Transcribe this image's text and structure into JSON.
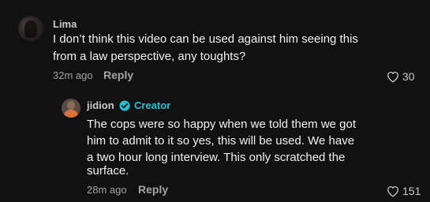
{
  "colors": {
    "background": "#111111",
    "creator_accent": "#20c0d6",
    "muted_text": "#a3a3a3"
  },
  "comment": {
    "username": "Lima",
    "lines": [
      "I don’t think this video can be used against him seeing this",
      "from a law perspective, any toughts?"
    ],
    "time": "32m ago",
    "reply_label": "Reply",
    "like_icon": "heart-outline-icon",
    "likes": "30"
  },
  "reply": {
    "username": "jidion",
    "badge_icon": "verified-check-icon",
    "creator_label": "Creator",
    "lines": [
      "The cops were so happy when we told them we got",
      "him to admit to it so yes, this will be used. We have",
      "a two hour long interview. This only scratched the",
      "surface."
    ],
    "time": "28m ago",
    "reply_label": "Reply",
    "like_icon": "heart-outline-icon",
    "likes": "151"
  }
}
